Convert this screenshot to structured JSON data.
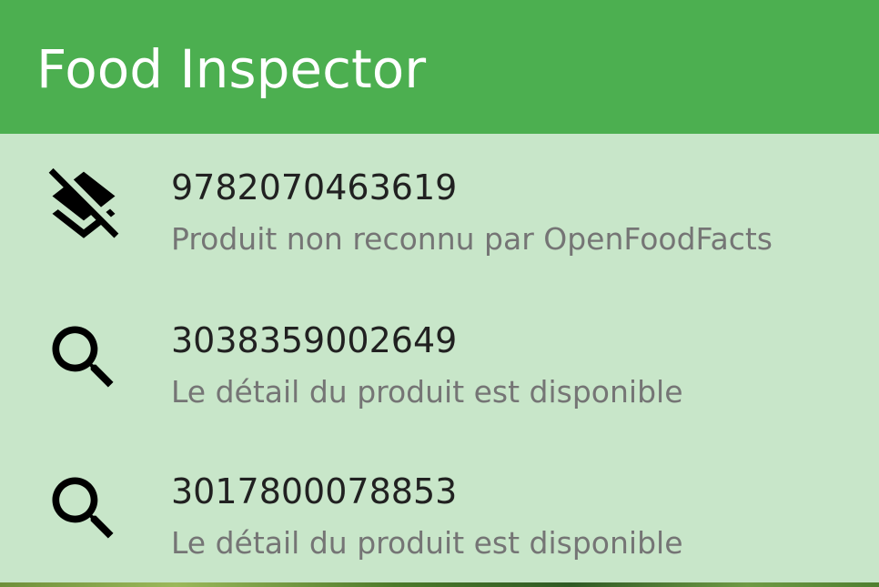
{
  "app_bar": {
    "title": "Food Inspector",
    "color": "#4caf50"
  },
  "list": {
    "background": "#c8e6c9",
    "items": [
      {
        "title": "9782070463619",
        "subtitle": "Produit non reconnu par OpenFoodFacts",
        "icon": "layers-clear-icon"
      },
      {
        "title": "3038359002649",
        "subtitle": "Le détail du produit est disponible",
        "icon": "search-icon"
      },
      {
        "title": "3017800078853",
        "subtitle": "Le détail du produit est disponible",
        "icon": "search-icon"
      }
    ]
  }
}
